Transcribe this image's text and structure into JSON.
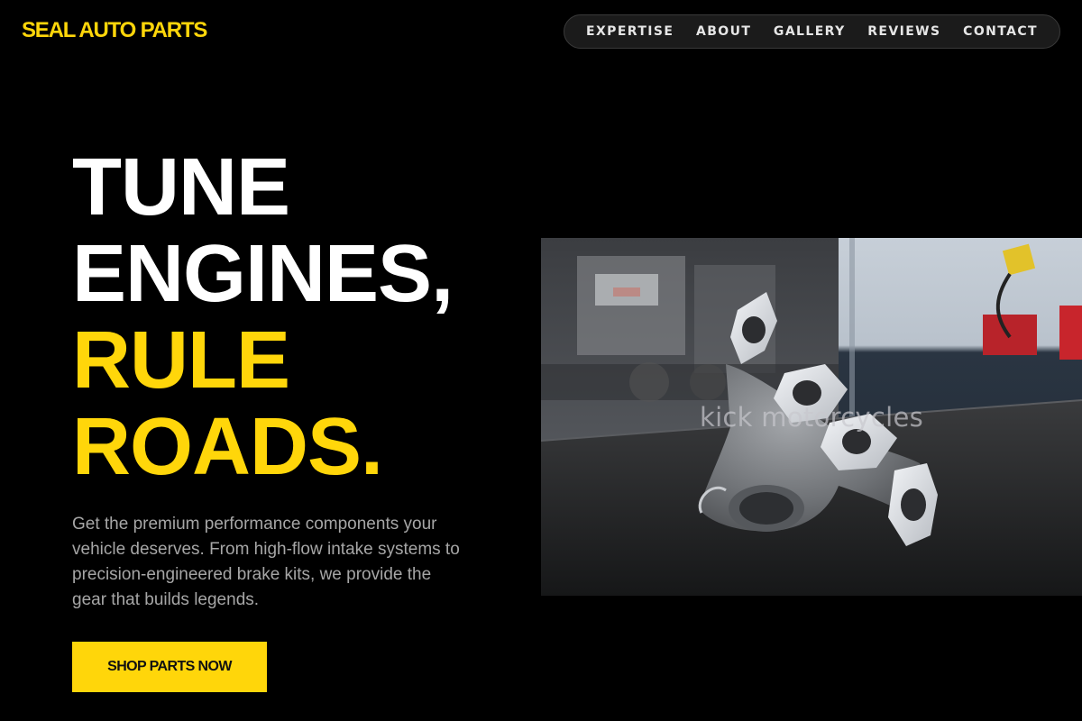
{
  "brand": {
    "logo_text": "SEAL AUTO PARTS",
    "accent_color": "#ffd60a"
  },
  "nav": {
    "items": [
      {
        "label": "EXPERTISE"
      },
      {
        "label": "ABOUT"
      },
      {
        "label": "GALLERY"
      },
      {
        "label": "REVIEWS"
      },
      {
        "label": "CONTACT"
      }
    ]
  },
  "hero": {
    "headline_lines": [
      {
        "text": "TUNE",
        "color": "#ffffff"
      },
      {
        "text": "ENGINES,",
        "color": "#ffffff"
      },
      {
        "text": "RULE",
        "color": "#ffd60a"
      },
      {
        "text": "ROADS.",
        "color": "#ffd60a"
      }
    ],
    "lead": "Get the premium performance components your vehicle deserves. From high-flow intake systems to precision-engineered brake kits, we provide the gear that builds legends.",
    "cta_label": "SHOP PARTS NOW"
  },
  "image": {
    "subject": "exhaust-manifold-photo",
    "watermark": "kick motorcycles"
  }
}
